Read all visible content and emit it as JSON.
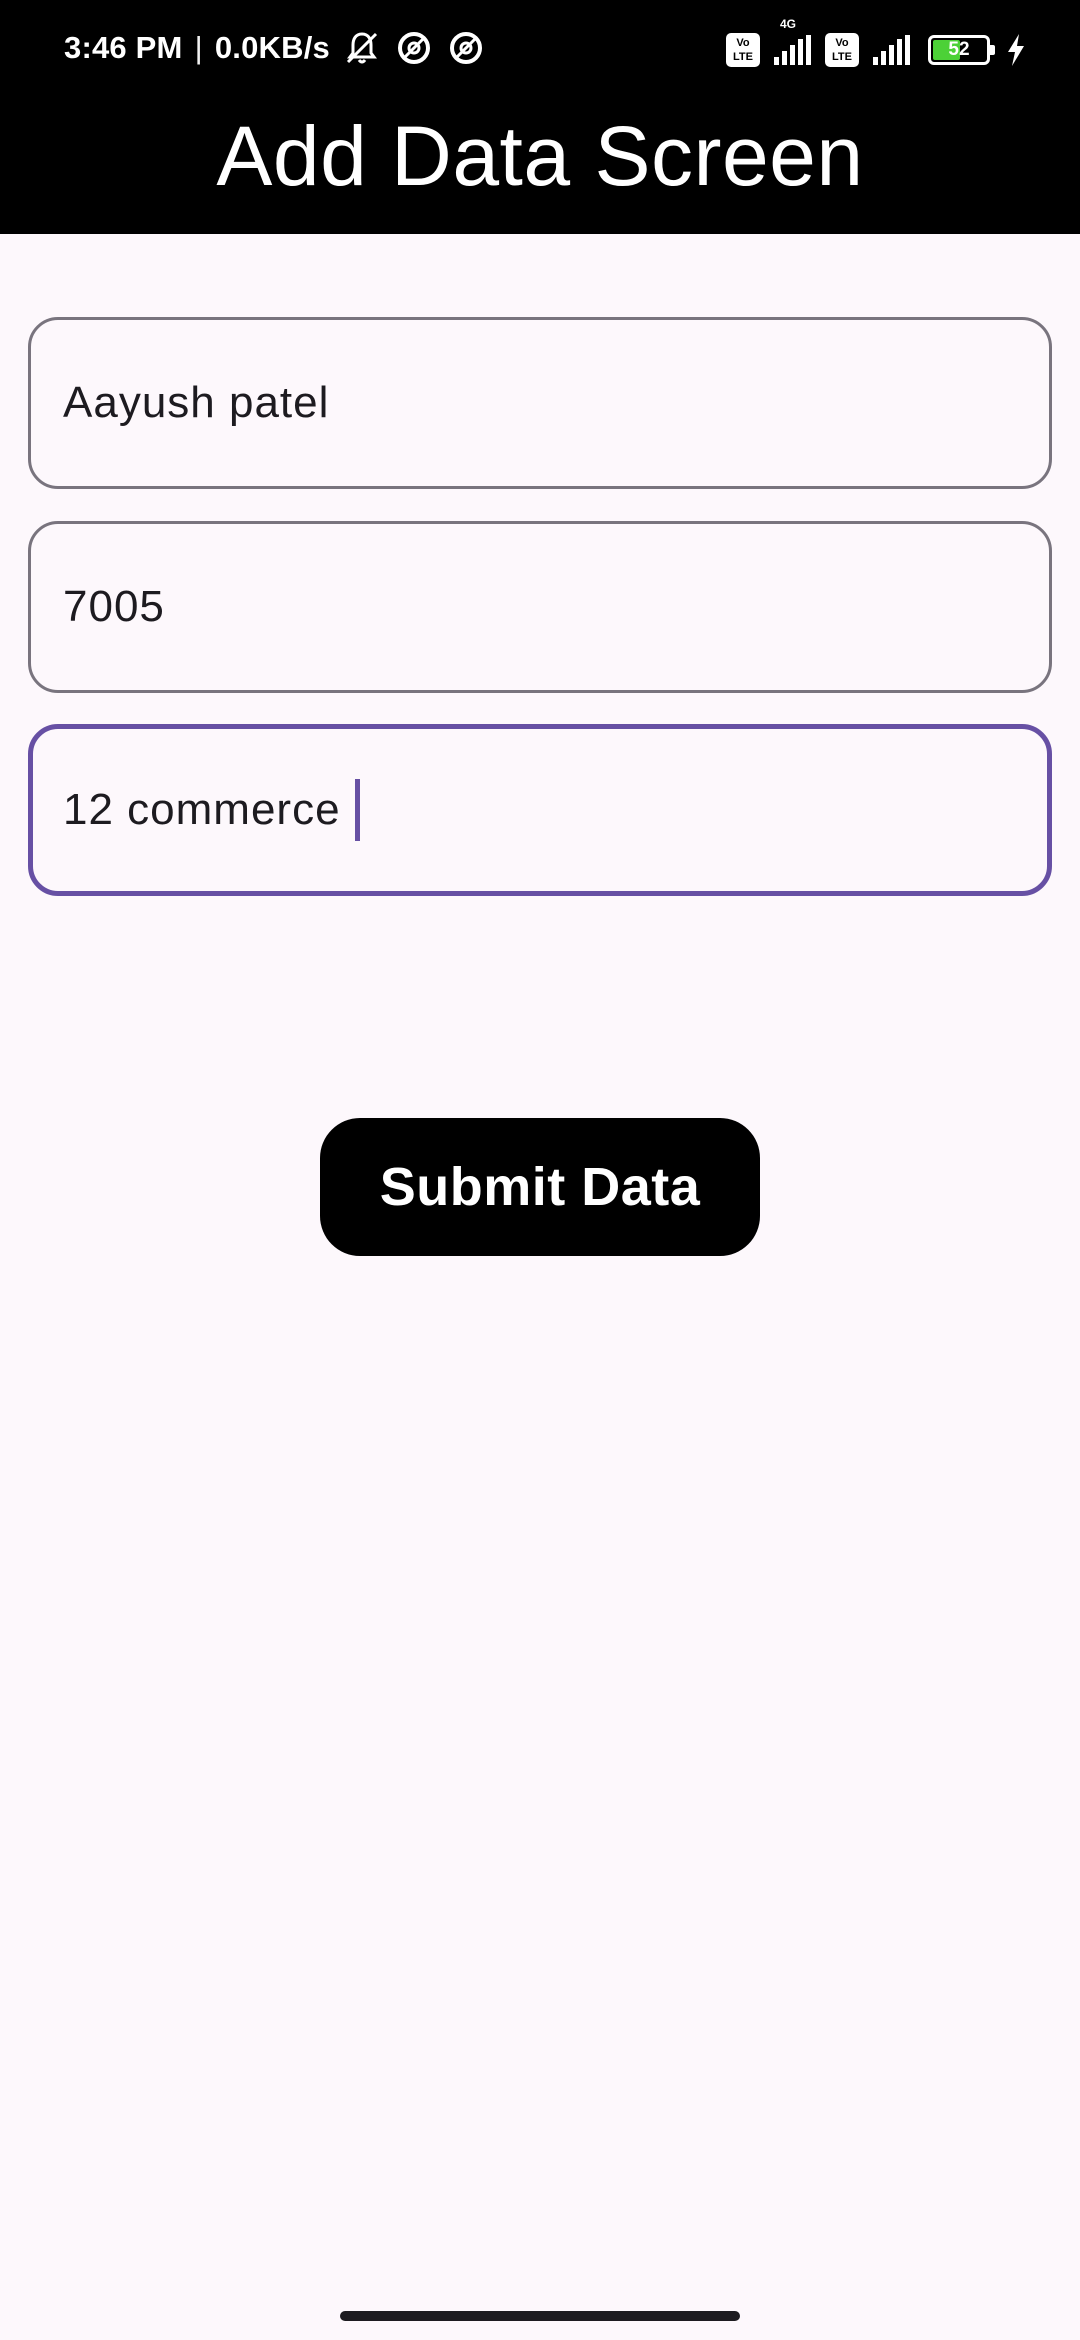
{
  "status_bar": {
    "time": "3:46 PM",
    "separator": "|",
    "network_speed": "0.0KB/s",
    "icons": [
      "bell-off-icon",
      "data-saver-icon",
      "data-saver-icon"
    ],
    "sim1_label": "Vo LTE",
    "network_type": "4G",
    "sim2_label": "Vo LTE",
    "battery_level": "52",
    "battery_fraction": 0.52,
    "battery_color": "#4cd137",
    "charging": true
  },
  "app_bar": {
    "title": "Add Data Screen",
    "background": "#000000"
  },
  "form": {
    "name_value": "Aayush patel",
    "number_value": "7005",
    "class_value": "12 commerce ",
    "focused_border_color": "#6750a4",
    "border_color": "#79747e"
  },
  "actions": {
    "submit_label": "Submit Data"
  }
}
